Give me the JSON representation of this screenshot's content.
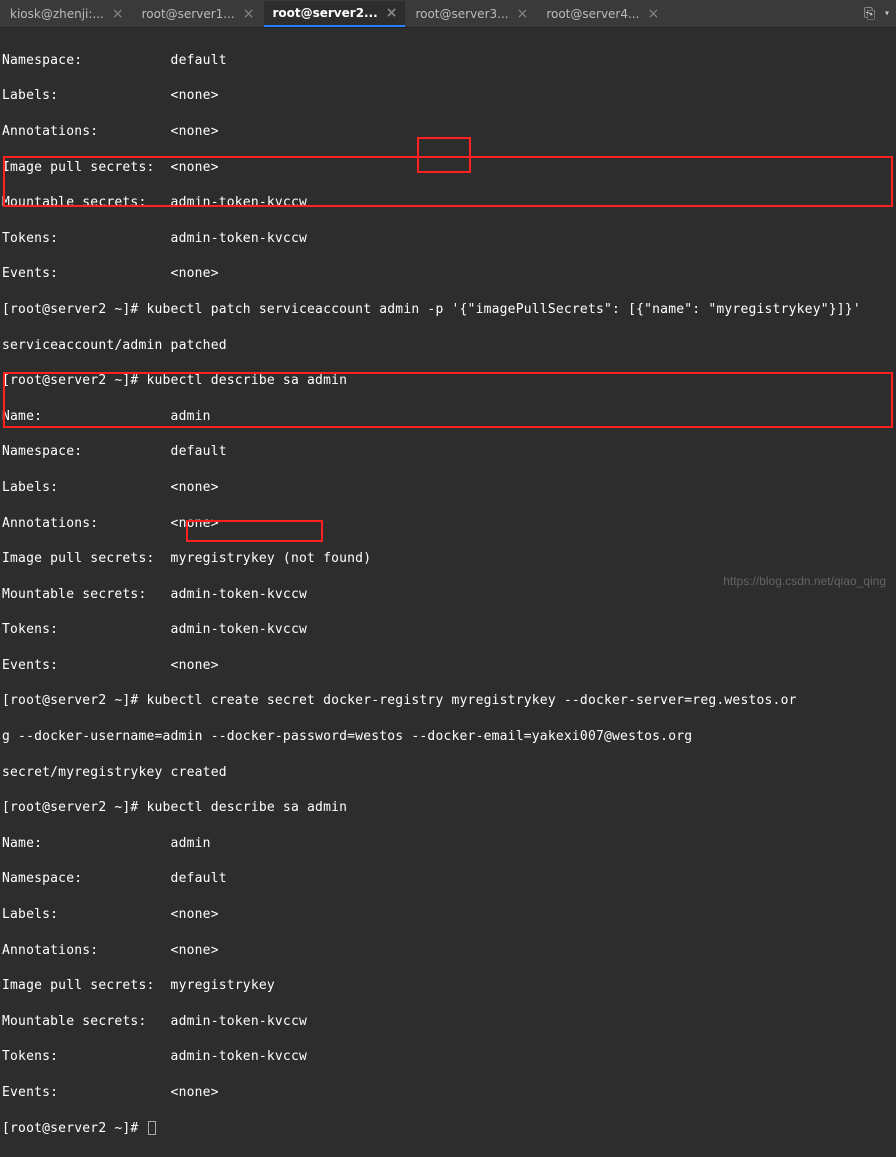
{
  "tabs": [
    {
      "label": "kiosk@zhenji:..."
    },
    {
      "label": "root@server1..."
    },
    {
      "label": "root@server2..."
    },
    {
      "label": "root@server3..."
    },
    {
      "label": "root@server4..."
    }
  ],
  "terminal": {
    "block1": {
      "l0": "Namespace:           default",
      "l1": "Labels:              <none>",
      "l2": "Annotations:         <none>",
      "l3": "Image pull secrets:  <none>",
      "l4": "Mountable secrets:   admin-token-kvccw",
      "l5": "Tokens:              admin-token-kvccw",
      "l6": "Events:              <none>"
    },
    "patch_cmd": "[root@server2 ~]# kubectl patch serviceaccount admin -p '{\"imagePullSecrets\": [{\"name\": \"myregistrykey\"}]}'",
    "patch_out": "serviceaccount/admin patched",
    "describe1_cmd": "[root@server2 ~]# kubectl describe sa admin",
    "block2": {
      "l0": "Name:                admin",
      "l1": "Namespace:           default",
      "l2": "Labels:              <none>",
      "l3": "Annotations:         <none>",
      "l4": "Image pull secrets:  myregistrykey (not found)",
      "l5": "Mountable secrets:   admin-token-kvccw",
      "l6": "Tokens:              admin-token-kvccw",
      "l7": "Events:              <none>"
    },
    "create_cmd_l1": "[root@server2 ~]# kubectl create secret docker-registry myregistrykey --docker-server=reg.westos.or",
    "create_cmd_l2": "g --docker-username=admin --docker-password=westos --docker-email=yakexi007@westos.org",
    "create_out": "secret/myregistrykey created",
    "describe2_cmd": "[root@server2 ~]# kubectl describe sa admin",
    "block3": {
      "l0": "Name:                admin",
      "l1": "Namespace:           default",
      "l2": "Labels:              <none>",
      "l3": "Annotations:         <none>",
      "l4": "Image pull secrets:  myregistrykey",
      "l5": "Mountable secrets:   admin-token-kvccw",
      "l6": "Tokens:              admin-token-kvccw",
      "l7": "Events:              <none>"
    },
    "final_prompt": "[root@server2 ~]# "
  },
  "watermark": "https://blog.csdn.net/qiao_qing"
}
